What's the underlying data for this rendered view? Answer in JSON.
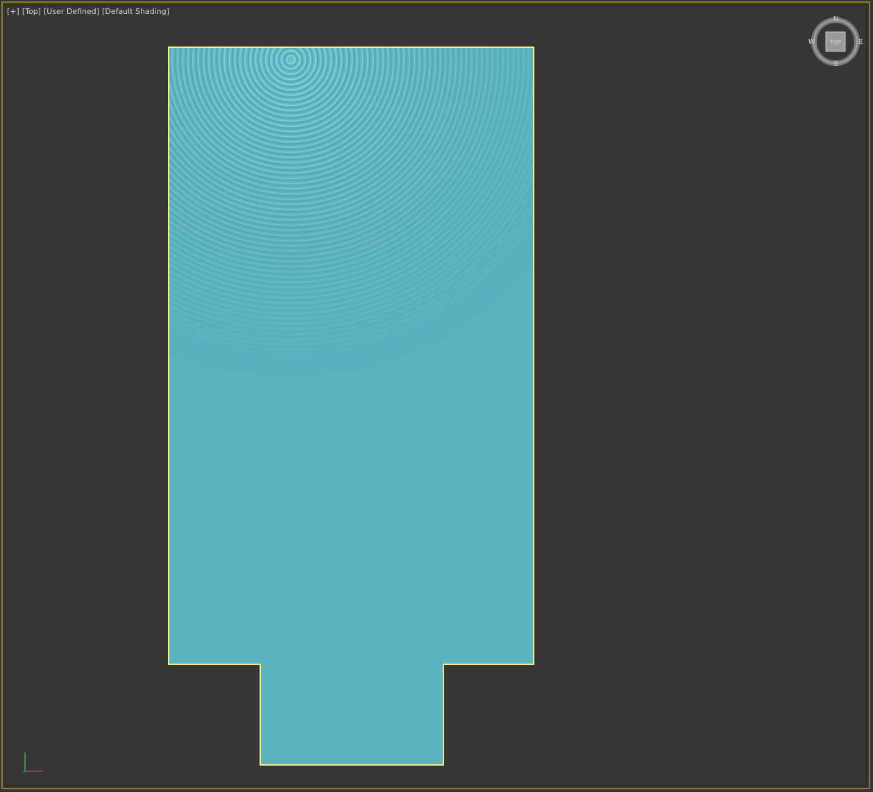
{
  "viewport": {
    "labels": [
      "+",
      "Top",
      "User Defined",
      "Default Shading"
    ]
  },
  "viewcube": {
    "face_label": "TOP",
    "compass": {
      "north": "N",
      "south": "S",
      "east": "E",
      "west": "W"
    }
  },
  "colors": {
    "background": "#363636",
    "viewport_border": "#8c7a2e",
    "water_surface": "#5bb1c0",
    "selection_outline": "#f2f27a",
    "axis_x": "#c0392b",
    "axis_y": "#3cb043",
    "axis_z": "#2f5fd0"
  },
  "icons": {
    "viewcube": "viewcube-icon",
    "axis": "axis-tripod-icon"
  }
}
